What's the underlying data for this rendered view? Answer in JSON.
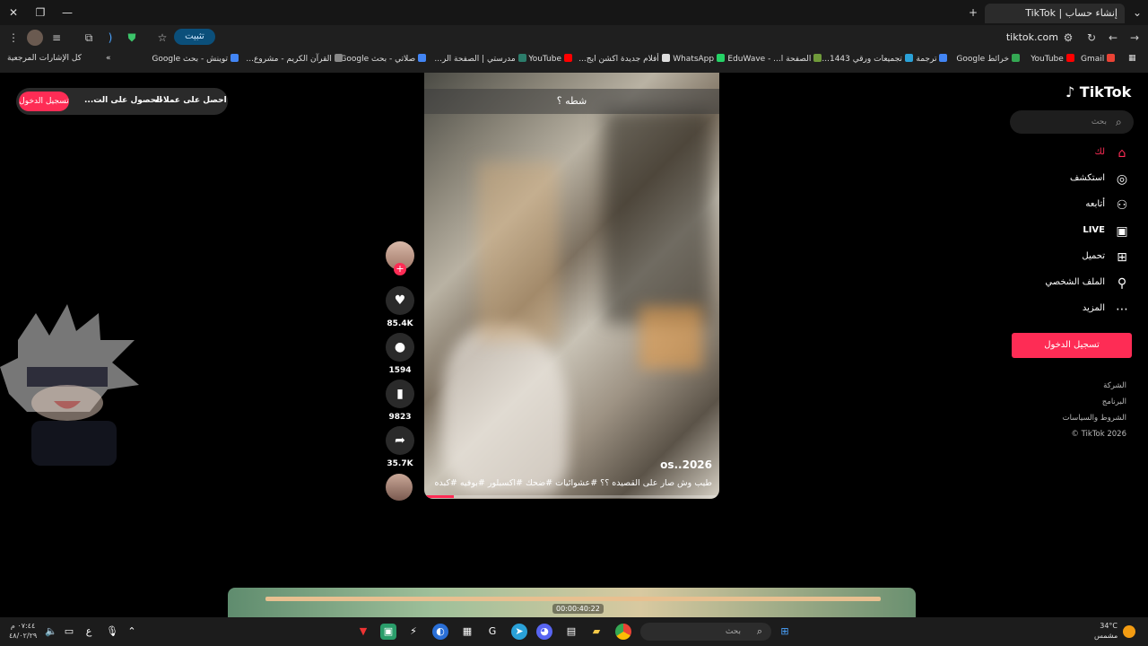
{
  "browser": {
    "tab_title": "إنشاء حساب | TikTok",
    "url": "tiktok.com",
    "install_label": "تثبيت",
    "bookmarks": [
      {
        "label": "Gmail",
        "color": "#ea4335"
      },
      {
        "label": "YouTube",
        "color": "#ff0000"
      },
      {
        "label": "خرائط Google",
        "color": "#34a853"
      },
      {
        "label": "ترجمة",
        "color": "#4285f4"
      },
      {
        "label": "تجميعات ورقي 1443...",
        "color": "#2aa1d8"
      },
      {
        "label": "الصفحة ا... - EduWave",
        "color": "#6f9a3a"
      },
      {
        "label": "WhatsApp",
        "color": "#25d366"
      },
      {
        "label": "أفلام جديدة اكشن ايج...",
        "color": "#dddddd"
      },
      {
        "label": "YouTube",
        "color": "#ff0000"
      },
      {
        "label": "مدرستي | الصفحة الر...",
        "color": "#2c7d6b"
      },
      {
        "label": "صلاتي - بحث Google",
        "color": "#4285f4"
      },
      {
        "label": "القرآن الكريم - مشروع...",
        "color": "#888888"
      },
      {
        "label": "توينش - بحث Google",
        "color": "#4285f4"
      }
    ],
    "all_bookmarks_label": "كل الإشارات المرجعية"
  },
  "top_pill": {
    "coins_label": "احصل على عملات",
    "app_label": "الحصول على الت...",
    "login_label": "تسجيل الدخول"
  },
  "video": {
    "overlay_text": "شطه ؟",
    "author": "os..2026",
    "description": "طيب وش صار على القصيده ؟؟ #عشوائيات #ضحك #اكسبلور #بوفيه #كبده",
    "progress": 0.1
  },
  "actions": {
    "likes": "85.4K",
    "comments": "1594",
    "saves": "9823",
    "shares": "35.7K"
  },
  "sidebar": {
    "logo": "TikTok",
    "search_placeholder": "بحث",
    "items": [
      {
        "label": "لك",
        "icon": "home-icon",
        "active": true
      },
      {
        "label": "استكشف",
        "icon": "compass-icon"
      },
      {
        "label": "أتابعه",
        "icon": "following-icon"
      },
      {
        "label": "LIVE",
        "icon": "live-icon"
      },
      {
        "label": "تحميل",
        "icon": "upload-icon"
      },
      {
        "label": "الملف الشخصي",
        "icon": "profile-icon"
      },
      {
        "label": "المزيد",
        "icon": "more-icon"
      }
    ],
    "login_button": "تسجيل الدخول",
    "footer": [
      "الشركة",
      "البرنامج",
      "الشروط والسياسات",
      "TikTok 2026 ©"
    ]
  },
  "preview": {
    "time": "00:00:40:22"
  },
  "taskbar": {
    "search_placeholder": "بحث",
    "time": "٠٧:٤٤ م",
    "date": "٤٨/٠٢/٢٩",
    "lang": "ع",
    "temp": "34°C",
    "weather": "مشمس"
  },
  "colors": {
    "accent": "#fe2c55"
  }
}
